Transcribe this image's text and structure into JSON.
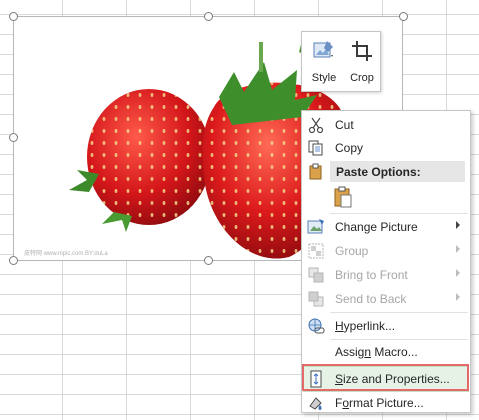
{
  "mini_toolbar": {
    "style_label": "Style",
    "crop_label": "Crop"
  },
  "picture": {
    "watermark": "皮特网 www.nipic.com  BY:duLa"
  },
  "context_menu": {
    "cut": "Cut",
    "copy": "Copy",
    "paste_options": "Paste Options:",
    "change_picture": "Change Picture",
    "group": "Group",
    "bring_to_front": "Bring to Front",
    "send_to_back": "Send to Back",
    "hyperlink": "Hyperlink...",
    "assign_macro": "Assign Macro...",
    "size_and_properties": "Size and Properties...",
    "format_picture": "Format Picture..."
  },
  "colors": {
    "highlight_border": "#e46a6a",
    "highlight_fill": "#e6f2e6",
    "strawberry": "#d61f1f"
  }
}
